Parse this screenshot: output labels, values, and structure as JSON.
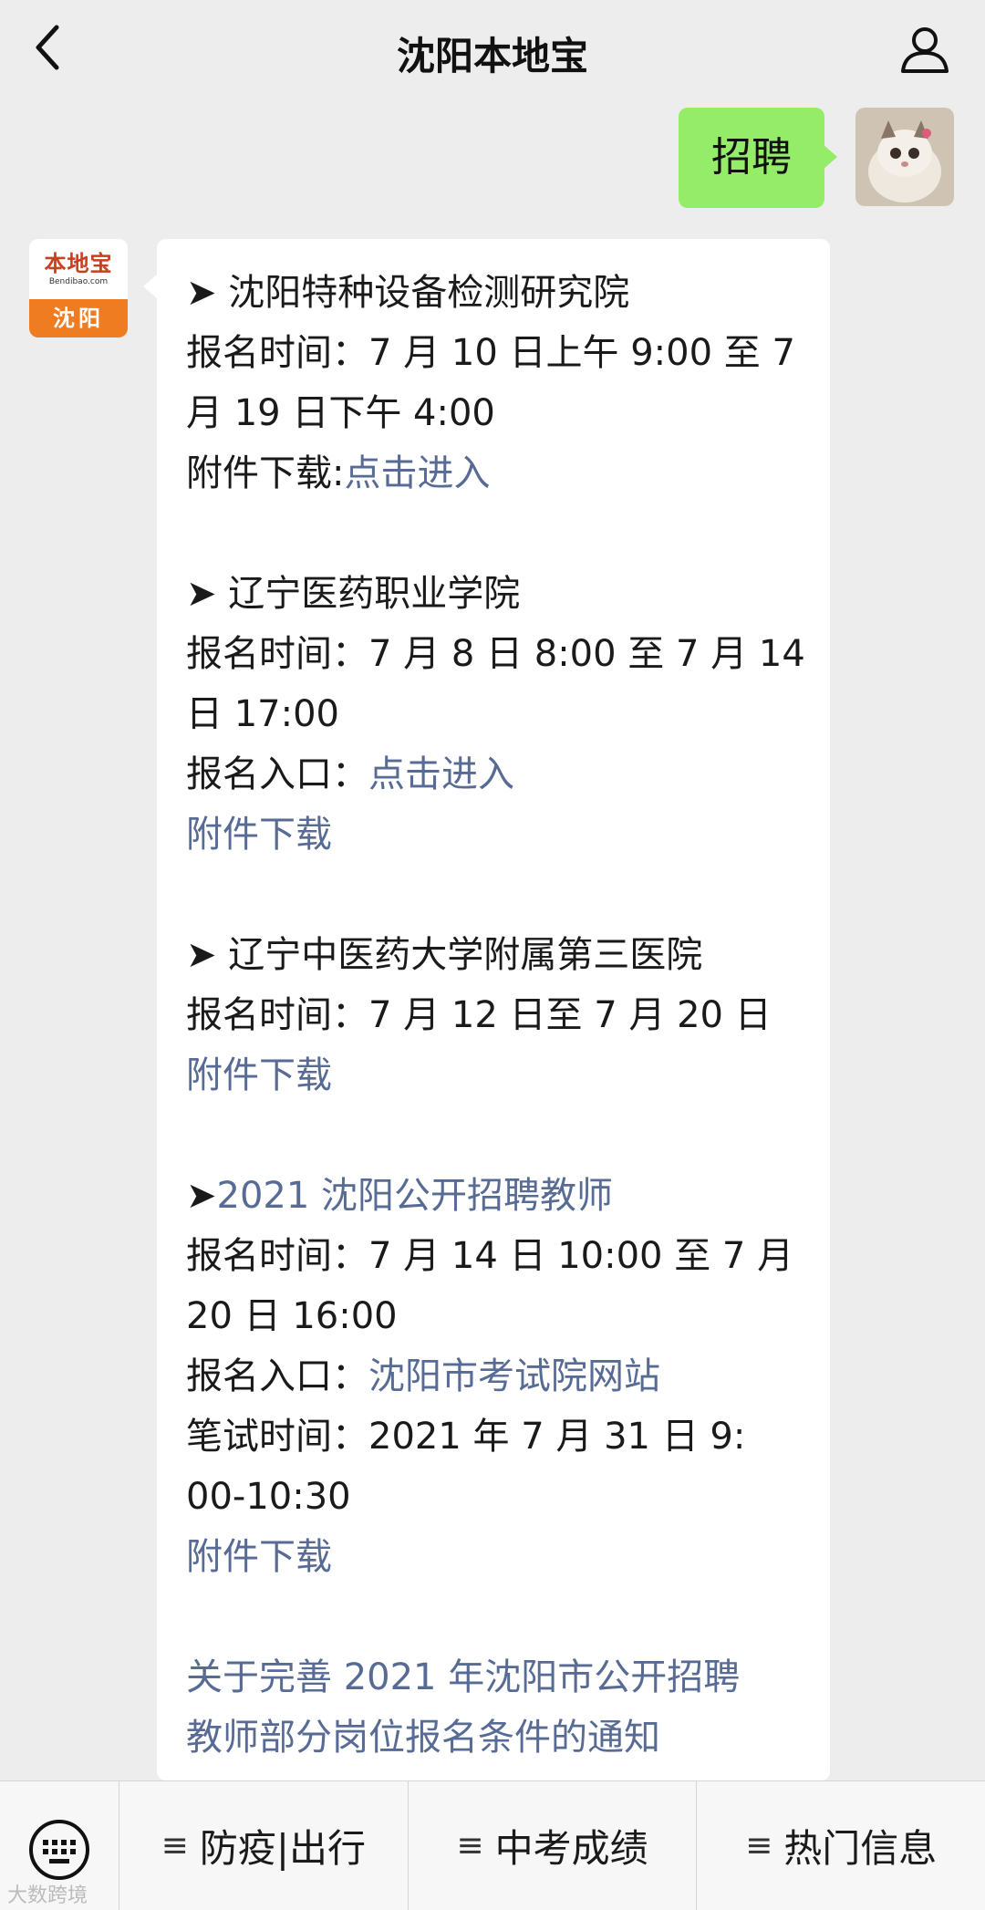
{
  "header": {
    "title": "沈阳本地宝"
  },
  "outgoing": {
    "text": "招聘"
  },
  "bot_avatar": {
    "brand": "本地宝",
    "sub": "Bendibao.com",
    "city": "沈阳"
  },
  "message": {
    "items": [
      {
        "title": "➤ 沈阳特种设备检测研究院",
        "time_lines": [
          "报名时间：7 月 10 日上午 9:00 至 7",
          "月 19 日下午 4:00"
        ],
        "attach_label": "附件下载:",
        "attach_link": "点击进入"
      },
      {
        "title": "➤ 辽宁医药职业学院",
        "time_lines": [
          "报名时间：7 月 8 日 8:00 至 7 月 14",
          "日 17:00"
        ],
        "entry_label": "报名入口：",
        "entry_link": "点击进入",
        "attach_link": "附件下载"
      },
      {
        "title": "➤ 辽宁中医药大学附属第三医院",
        "time_lines": [
          "报名时间：7 月 12 日至 7 月 20 日"
        ],
        "attach_link": "附件下载"
      },
      {
        "arrow": "➤",
        "title_link": "2021 沈阳公开招聘教师",
        "time_lines": [
          "报名时间：7 月 14 日 10:00 至 7 月",
          "20 日 16:00"
        ],
        "entry_label": "报名入口：",
        "entry_link": "沈阳市考试院网站",
        "exam_lines": [
          "笔试时间：2021 年 7 月 31 日 9:",
          "00-10:30"
        ],
        "attach_link": "附件下载"
      }
    ],
    "notice_lines": [
      "关于完善 2021 年沈阳市公开招聘",
      "教师部分岗位报名条件的通知"
    ]
  },
  "menu": {
    "items": [
      "防疫|出行",
      "中考成绩",
      "热门信息"
    ],
    "hamburger": "≡"
  },
  "watermark": "大数跨境",
  "colors": {
    "link": "#576b95",
    "bubble_out": "#95ec69",
    "background": "#ededed"
  }
}
